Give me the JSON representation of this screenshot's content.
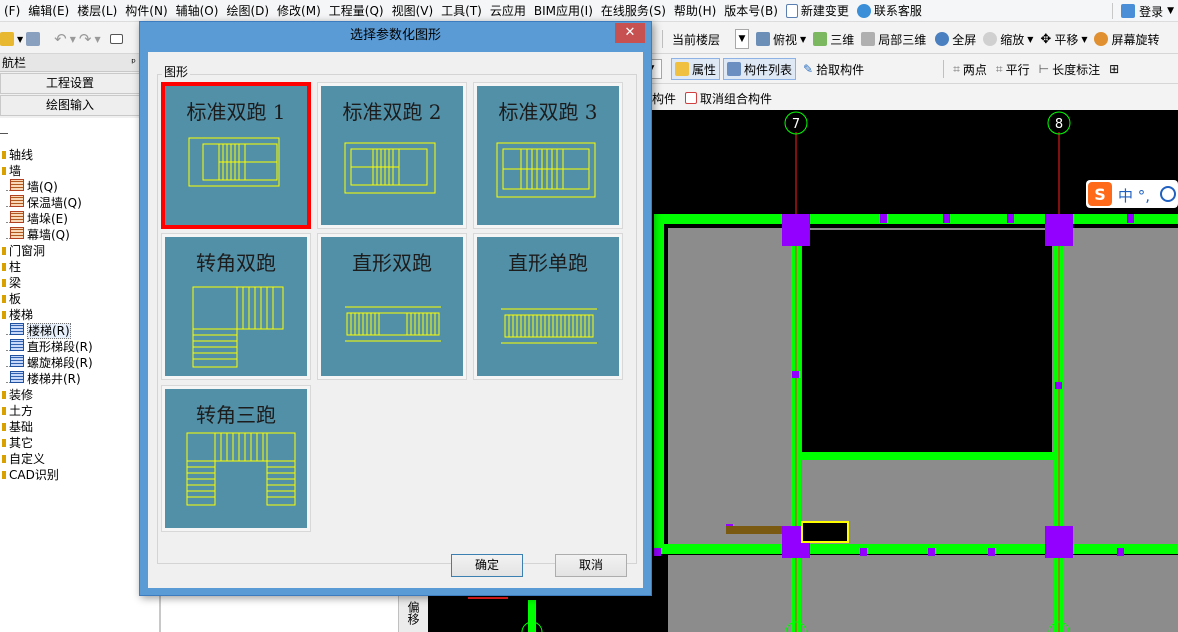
{
  "menubar": {
    "items": [
      "(F)",
      "编辑(E)",
      "楼层(L)",
      "构件(N)",
      "辅轴(O)",
      "绘图(D)",
      "修改(M)",
      "工程量(Q)",
      "视图(V)",
      "工具(T)",
      "云应用",
      "BIM应用(I)",
      "在线服务(S)",
      "帮助(H)",
      "版本号(B)"
    ],
    "new_change": "新建变更",
    "contact": "联系客服",
    "login": "登录"
  },
  "toolbar": {
    "current_floor": "当前楼层",
    "top_view": "俯视",
    "three_d": "三维",
    "local_3d": "局部三维",
    "fullscreen": "全屏",
    "zoom": "缩放",
    "pan": "平移",
    "screen_rotate": "屏幕旋转",
    "properties": "属性",
    "component_list": "构件列表",
    "pick_component": "拾取构件",
    "two_points": "两点",
    "parallel": "平行",
    "length_mark": "长度标注",
    "component": "构件",
    "cancel_group": "取消组合构件"
  },
  "nav": {
    "title": "航栏",
    "pin": "ᵖ",
    "project_settings": "工程设置",
    "drawing_input": "绘图输入",
    "tree": [
      {
        "label": "轴线",
        "level": 0,
        "icon": "folder"
      },
      {
        "label": "墙",
        "level": 0,
        "icon": "folder"
      },
      {
        "label": "墙(Q)",
        "level": 1,
        "icon": "wall"
      },
      {
        "label": "保温墙(Q)",
        "level": 1,
        "icon": "wall"
      },
      {
        "label": "墙垛(E)",
        "level": 1,
        "icon": "wall"
      },
      {
        "label": "幕墙(Q)",
        "level": 1,
        "icon": "wall"
      },
      {
        "label": "门窗洞",
        "level": 0,
        "icon": "folder"
      },
      {
        "label": "柱",
        "level": 0,
        "icon": "folder"
      },
      {
        "label": "梁",
        "level": 0,
        "icon": "folder"
      },
      {
        "label": "板",
        "level": 0,
        "icon": "folder"
      },
      {
        "label": "楼梯",
        "level": 0,
        "icon": "folder"
      },
      {
        "label": "楼梯(R)",
        "level": 1,
        "icon": "stair"
      },
      {
        "label": "直形梯段(R)",
        "level": 1,
        "icon": "stair"
      },
      {
        "label": "螺旋梯段(R)",
        "level": 1,
        "icon": "stair"
      },
      {
        "label": "楼梯井(R)",
        "level": 1,
        "icon": "stair"
      },
      {
        "label": "装修",
        "level": 0,
        "icon": "folder"
      },
      {
        "label": "土方",
        "level": 0,
        "icon": "folder"
      },
      {
        "label": "基础",
        "level": 0,
        "icon": "folder"
      },
      {
        "label": "其它",
        "level": 0,
        "icon": "folder"
      },
      {
        "label": "自定义",
        "level": 0,
        "icon": "folder"
      },
      {
        "label": "CAD识别",
        "level": 0,
        "icon": "folder"
      }
    ]
  },
  "side_panel": {
    "vertical_text": "偏移"
  },
  "canvas": {
    "axis_7": "7",
    "axis_8": "8",
    "ime": "中 °,"
  },
  "dialog": {
    "title": "选择参数化图形",
    "close": "✕",
    "group_label": "图形",
    "shapes": [
      {
        "label": "标准双跑 1",
        "selected": true
      },
      {
        "label": "标准双跑 2",
        "selected": false
      },
      {
        "label": "标准双跑 3",
        "selected": false
      },
      {
        "label": "转角双跑",
        "selected": false
      },
      {
        "label": "直形双跑",
        "selected": false
      },
      {
        "label": "直形单跑",
        "selected": false
      },
      {
        "label": "转角三跑",
        "selected": false
      }
    ],
    "ok": "确定",
    "cancel": "取消"
  }
}
